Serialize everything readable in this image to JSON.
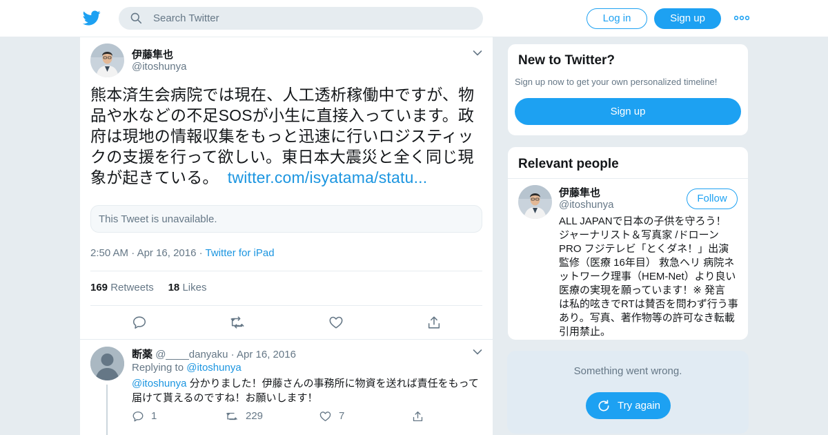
{
  "header": {
    "search_placeholder": "Search Twitter",
    "login_label": "Log in",
    "signup_label": "Sign up"
  },
  "tweet": {
    "author_name": "伊藤隼也",
    "author_handle": "@itoshunya",
    "text_lines": [
      "熊本済生会病院では現在、人工透析稼働中ですが、物",
      "品や水などの不足SOSが小生に直接入っています。政",
      "府は現地の情報収集をもっと迅速に行いロジスティッ",
      "クの支援を行って欲しい。東日本大震災と全く同じ現",
      "象が起きている。"
    ],
    "link_text": "twitter.com/isyatama/statu...",
    "quoted_unavailable": "This Tweet is unavailable.",
    "time": "2:50 AM",
    "date": "Apr 16, 2016",
    "source": "Twitter for iPad",
    "retweets_count": "169",
    "retweets_label": "Retweets",
    "likes_count": "18",
    "likes_label": "Likes"
  },
  "reply": {
    "author_name": "断薬",
    "author_handle": "@____danyaku",
    "date": "Apr 16, 2016",
    "replying_prefix": "Replying to",
    "replying_to": "@itoshunya",
    "mention": "@itoshunya",
    "text_line1": "分かりました！伊藤さんの事務所に物資を送れば責任をもって",
    "text_line2": "届けて貰えるのですね！お願いします！",
    "replies_count": "1",
    "retweets_count": "229",
    "likes_count": "7"
  },
  "new_to_twitter": {
    "title": "New to Twitter?",
    "subtitle": "Sign up now to get your own personalized timeline!",
    "signup_label": "Sign up"
  },
  "relevant_people": {
    "title": "Relevant people",
    "name": "伊藤隼也",
    "handle": "@itoshunya",
    "follow_label": "Follow",
    "bio_lines": [
      "ALL JAPANで日本の子供を守ろう！",
      "ジャーナリスト＆写真家 /ドローン",
      "PRO フジテレビ「とくダネ！」出演",
      "監修（医療 16年目） 救急ヘリ 病院ネ",
      "ットワーク理事（HEM-Net）より良い",
      "医療の実現を願っています！※ 発言",
      "は私的呟きでRTは賛否を問わず行う事",
      "あり。写真、著作物等の許可なき転載",
      "引用禁止。"
    ]
  },
  "error_card": {
    "message": "Something went wrong.",
    "retry_label": "Try again"
  },
  "colors": {
    "brand_blue": "#1da1f2",
    "link_blue": "#1b95e0",
    "muted_text": "#657786",
    "background": "#e6ecf0"
  }
}
